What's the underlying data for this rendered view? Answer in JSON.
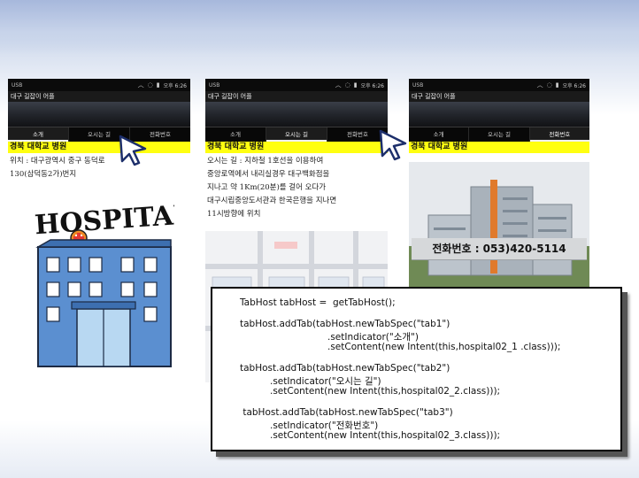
{
  "phones": [
    {
      "status_left": "USB",
      "clock": "오후 6:26",
      "app_title": "대구 길잡이 어플",
      "tabs": [
        "소개",
        "오시는 길",
        "전화번호"
      ],
      "active_tab": 0,
      "content_title": "경북 대학교 병원",
      "body_text": "위치 : 대구광역시 중구 동덕로\n130(삼덕동2가)번지",
      "image_label": "HOSPITAL"
    },
    {
      "status_left": "USB",
      "clock": "오후 6:26",
      "app_title": "대구 길잡이 어플",
      "tabs": [
        "소개",
        "오시는 길",
        "전화번호"
      ],
      "active_tab": 1,
      "content_title": "경북 대학교 병원",
      "body_text": "오시는 길 : 지하철 1호선을 이용하여\n중앙로역에서 내리실경우 대구백화점을\n지나고 약 1Km(20분)를 걸어 오다가\n대구시립중앙도서관과 한국은행을 지나면\n11시방향에 위치"
    },
    {
      "status_left": "USB",
      "clock": "오후 6:26",
      "app_title": "대구 길잡이 어플",
      "tabs": [
        "소개",
        "오시는 길",
        "전화번호"
      ],
      "active_tab": 2,
      "content_title": "경북 대학교 병원",
      "phone_number": "전화번호 : 053)420-5114"
    }
  ],
  "code": {
    "lines": [
      "TabHost tabHost =  getTabHost();",
      "tabHost.addTab(tabHost.newTabSpec(\"tab1\")",
      ".setIndicator(\"소개\")",
      ".setContent(new Intent(this,hospital02_1 .class)));",
      "tabHost.addTab(tabHost.newTabSpec(\"tab2\")",
      ".setIndicator(\"오시는 길\")",
      ".setContent(new Intent(this,hospital02_2.class)));",
      " tabHost.addTab(tabHost.newTabSpec(\"tab3\")",
      ".setIndicator(\"전화번호\")",
      ".setContent(new Intent(this,hospital02_3.class)));"
    ]
  },
  "colors": {
    "content_title_bg": "#ffff10",
    "status_bar_bg": "#0b0b0b",
    "slide_accent": "#b9c8e4"
  },
  "icons": [
    "mouse-pointer-icon",
    "wifi-icon",
    "battery-icon",
    "signal-icon",
    "hospital-building-icon",
    "map-icon"
  ]
}
